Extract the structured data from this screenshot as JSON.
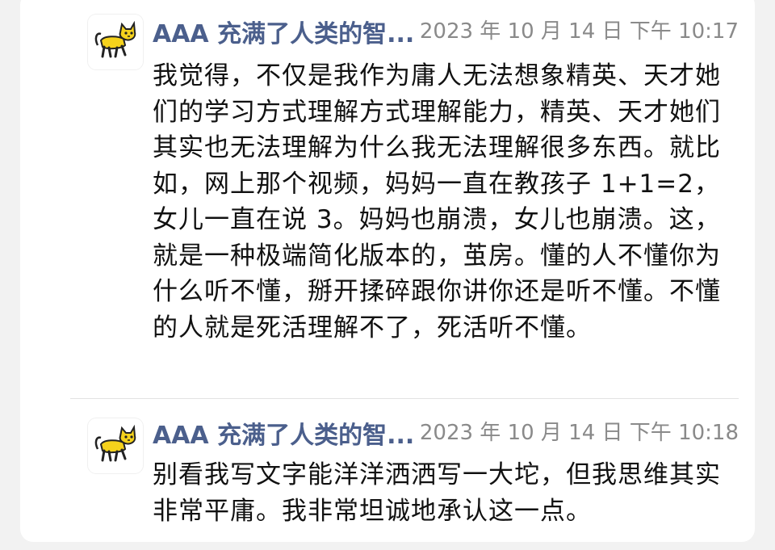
{
  "messages": [
    {
      "sender": "AAA 充满了人类的智...",
      "time": "2023 年 10 月 14 日 下午 10:17",
      "text": "我觉得，不仅是我作为庸人无法想象精英、天才她们的学习方式理解方式理解能力，精英、天才她们其实也无法理解为什么我无法理解很多东西。就比如，网上那个视频，妈妈一直在教孩子 1+1=2，女儿一直在说 3。妈妈也崩溃，女儿也崩溃。这，就是一种极端简化版本的，茧房。懂的人不懂你为什么听不懂，掰开揉碎跟你讲你还是听不懂。不懂的人就是死活理解不了，死活听不懂。"
    },
    {
      "sender": "AAA 充满了人类的智...",
      "time": "2023 年 10 月 14 日 下午 10:18",
      "text": "别看我写文字能洋洋洒洒写一大坨，但我思维其实非常平庸。我非常坦诚地承认这一点。"
    }
  ],
  "colors": {
    "sender": "#4b5f8c",
    "time": "#8a8a8a",
    "text": "#111111",
    "avatar_cat": "#f5d21c"
  },
  "icons": {
    "avatar": "yellow-cat-icon"
  }
}
